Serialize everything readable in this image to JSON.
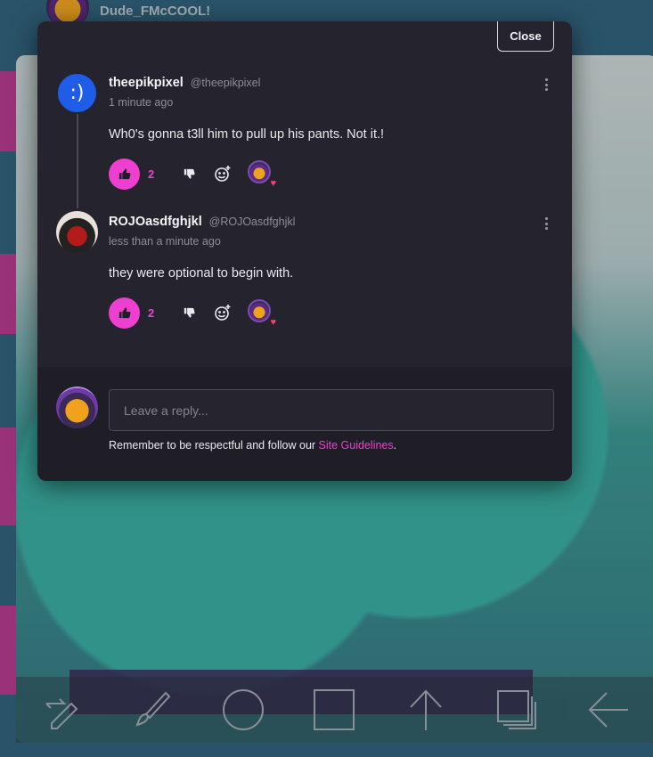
{
  "background": {
    "username": "Dude_FMcCOOL!",
    "toolbar": [
      "swap-tool-icon",
      "brush-icon",
      "circle-icon",
      "square-icon",
      "arrow-up-icon",
      "layers-icon",
      "back-arrow-icon"
    ]
  },
  "modal": {
    "close_label": "Close",
    "comments": [
      {
        "avatar_text": ":)",
        "author": "theepikpixel",
        "handle": "@theepikpixel",
        "time": "1 minute ago",
        "body": "Wh0's gonna t3ll him to pull up his pants. Not it.!",
        "likes": "2",
        "reactor_icon": "reactor-avatar-heart"
      },
      {
        "avatar_text": "",
        "author": "ROJOasdfghjkl",
        "handle": "@ROJOasdfghjkl",
        "time": "less than a minute ago",
        "body": "they were optional to begin with.",
        "likes": "2",
        "reactor_icon": "reactor-avatar-heart"
      }
    ],
    "reply": {
      "placeholder": "Leave a reply...",
      "guidelines_prefix": "Remember to be respectful and follow our ",
      "guidelines_link": "Site Guidelines",
      "guidelines_suffix": "."
    }
  },
  "colors": {
    "accent": "#ee3fd1",
    "modal_bg": "#25242e",
    "reply_bg": "#1f1e27",
    "heart": "#ff3d6e"
  }
}
